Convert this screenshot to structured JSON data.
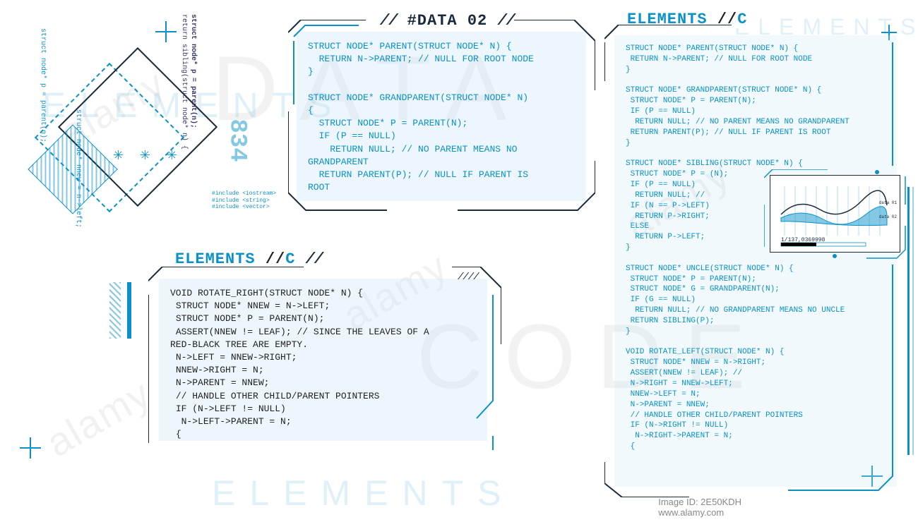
{
  "bg": {
    "data": "DATA",
    "code": "CODE",
    "elements": "ELEMENTS",
    "elements2": "ELEMENTS",
    "elements3": "ELEMENTS"
  },
  "panel_data02": {
    "title": "#DATA 02",
    "code": "STRUCT NODE* PARENT(STRUCT NODE* N) {\n  RETURN N->PARENT; // NULL FOR ROOT NODE\n}\n\nSTRUCT NODE* GRANDPARENT(STRUCT NODE* N)\n{\n  STRUCT NODE* P = PARENT(N);\n  IF (P == NULL)\n    RETURN NULL; // NO PARENT MEANS NO\nGRANDPARENT\n  RETURN PARENT(P); // NULL IF PARENT IS\nROOT"
  },
  "panel_elements_c": {
    "title_main": "ELEMENTS",
    "title_sep": "//",
    "title_suf": "C",
    "code": "VOID ROTATE_RIGHT(STRUCT NODE* N) {\n STRUCT NODE* NNEW = N->LEFT;\n STRUCT NODE* P = PARENT(N);\n ASSERT(NNEW != LEAF); // SINCE THE LEAVES OF A\nRED-BLACK TREE ARE EMPTY.\n N->LEFT = NNEW->RIGHT;\n NNEW->RIGHT = N;\n N->PARENT = NNEW;\n // HANDLE OTHER CHILD/PARENT POINTERS\n IF (N->LEFT != NULL)\n  N->LEFT->PARENT = N;\n {"
  },
  "panel_elements_right": {
    "title_main": "ELEMENTS",
    "title_sep": "//",
    "title_suf": "C",
    "code": "STRUCT NODE* PARENT(STRUCT NODE* N) {\n RETURN N->PARENT; // NULL FOR ROOT NODE\n}\n\nSTRUCT NODE* GRANDPARENT(STRUCT NODE* N) {\n STRUCT NODE* P = PARENT(N);\n IF (P == NULL)\n  RETURN NULL; // NO PARENT MEANS NO GRANDPARENT\n RETURN PARENT(P); // NULL IF PARENT IS ROOT\n}\n\nSTRUCT NODE* SIBLING(STRUCT NODE* N) {\n STRUCT NODE* P = (N);\n IF (P == NULL)\n  RETURN NULL; //\n IF (N == P->LEFT)\n  RETURN P->RIGHT;\n ELSE\n  RETURN P->LEFT;\n}\n\nSTRUCT NODE* UNCLE(STRUCT NODE* N) {\n STRUCT NODE* P = PARENT(N);\n STRUCT NODE* G = GRANDPARENT(N);\n IF (G == NULL)\n  RETURN NULL; // NO GRANDPARENT MEANS NO UNCLE\n RETURN SIBLING(P);\n}\n\nVOID ROTATE_LEFT(STRUCT NODE* N) {\n STRUCT NODE* NNEW = N->RIGHT;\n ASSERT(NNEW != LEAF); //\n N->RIGHT = NNEW->LEFT;\n NNEW->LEFT = N;\n N->PARENT = NNEW;\n // HANDLE OTHER CHILD/PARENT POINTERS\n IF (N->RIGHT != NULL)\n  N->RIGHT->PARENT = N;\n {"
  },
  "decor": {
    "num": "834",
    "vert1": "struct node* p = parent(n);",
    "vert2": "return sibling(struct node* n) {",
    "vert3": "struct node* nnew = n->left;",
    "vert4": "struct node* p = parent(n);",
    "incl1": "#include <iostream>",
    "incl2": "#include <string>",
    "incl3": "#include <vector>"
  },
  "chart": {
    "label": "1/137,0369998",
    "legend1": "data 01",
    "legend2": "data 02"
  },
  "watermark": {
    "text": "alamy",
    "ref": "Image ID: 2E50KDH\nwww.alamy.com"
  }
}
